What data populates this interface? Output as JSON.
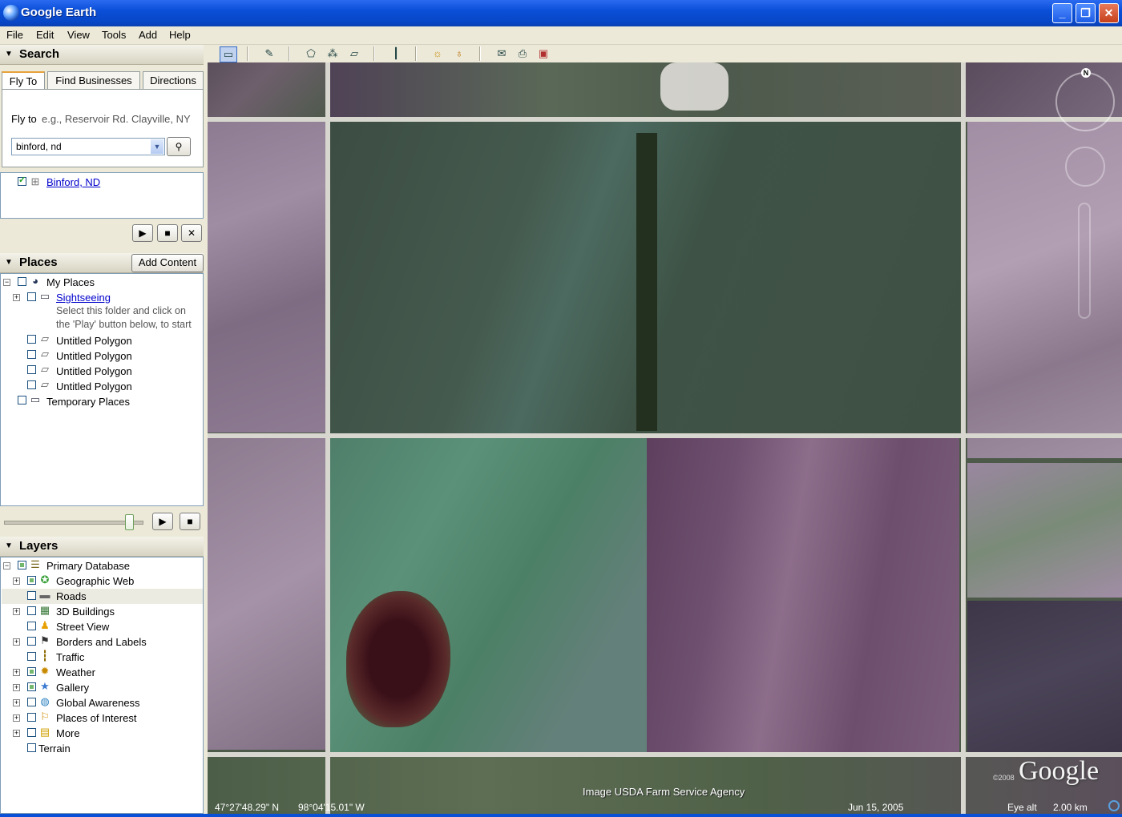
{
  "window": {
    "title": "Google Earth"
  },
  "menu": [
    "File",
    "Edit",
    "View",
    "Tools",
    "Add",
    "Help"
  ],
  "toolbar_icons": [
    "sidebar-toggle-icon",
    "placemark-icon",
    "polygon-icon",
    "path-icon",
    "image-overlay-icon",
    "ruler-icon",
    "sun-icon",
    "planet-icon",
    "email-icon",
    "print-icon",
    "google-maps-icon"
  ],
  "search": {
    "header": "Search",
    "tabs": [
      "Fly To",
      "Find Businesses",
      "Directions"
    ],
    "fly_to_label": "Fly to",
    "fly_to_hint": "e.g., Reservoir Rd. Clayville, NY",
    "query": "binford, nd",
    "result": "Binford, ND"
  },
  "places": {
    "header": "Places",
    "add_content": "Add Content",
    "items": [
      {
        "label": "My Places"
      },
      {
        "label": "Sightseeing"
      },
      {
        "label": "Select this folder and click on"
      },
      {
        "label": "the 'Play' button below, to start"
      },
      {
        "label": "Untitled Polygon"
      },
      {
        "label": "Untitled Polygon"
      },
      {
        "label": "Untitled Polygon"
      },
      {
        "label": "Untitled Polygon"
      },
      {
        "label": "Temporary Places"
      }
    ]
  },
  "layers": {
    "header": "Layers",
    "items": [
      {
        "label": "Primary Database"
      },
      {
        "label": "Geographic Web"
      },
      {
        "label": "Roads"
      },
      {
        "label": "3D Buildings"
      },
      {
        "label": "Street View"
      },
      {
        "label": "Borders and Labels"
      },
      {
        "label": "Traffic"
      },
      {
        "label": "Weather"
      },
      {
        "label": "Gallery"
      },
      {
        "label": "Global Awareness"
      },
      {
        "label": "Places of Interest"
      },
      {
        "label": "More"
      },
      {
        "label": "Terrain"
      }
    ]
  },
  "tour_slider_value": 0.9,
  "map": {
    "compass_label": "N",
    "copyright_year": "©2008",
    "logo": "Google",
    "attribution": "Image USDA Farm Service Agency",
    "lat": "47°27'48.29\" N",
    "lon": "98°04'15.01\" W",
    "date": "Jun 15, 2005",
    "eye_alt_label": "Eye alt",
    "eye_alt": "2.00 km"
  }
}
